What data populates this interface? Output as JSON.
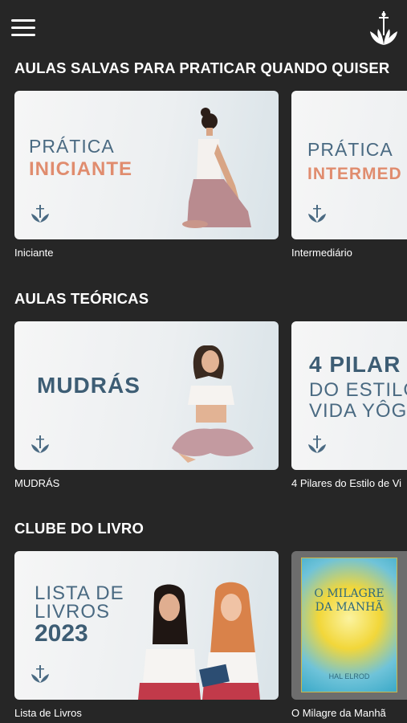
{
  "sections": [
    {
      "title": "AULAS SALVAS PARA PRATICAR QUANDO QUISER",
      "items": [
        {
          "caption": "Iniciante",
          "thumb_line1": "PRÁTICA",
          "thumb_line2": "INICIANTE"
        },
        {
          "caption": "Intermediário",
          "thumb_line1": "PRÁTICA",
          "thumb_line2": "INTERMED"
        }
      ]
    },
    {
      "title": "AULAS TEÓRICAS",
      "items": [
        {
          "caption": "MUDRÁS",
          "thumb_title": "MUDRÁS"
        },
        {
          "caption": "4 Pilares do Estilo de Vi",
          "thumb_l1": "4 PILAR",
          "thumb_l2": "DO ESTILO",
          "thumb_l3": "VIDA YÔGI"
        }
      ]
    },
    {
      "title": "CLUBE DO LIVRO",
      "items": [
        {
          "caption": "Lista de Livros",
          "thumb_l1": "LISTA DE",
          "thumb_l2": "LIVROS",
          "thumb_year": "2023"
        },
        {
          "caption": "O Milagre da Manhã",
          "book_title": "O MILAGRE DA MANHÃ",
          "book_author": "HAL ELROD"
        }
      ]
    }
  ],
  "icons": {
    "menu": "hamburger-menu-icon",
    "logo": "lotus-logo-icon"
  },
  "colors": {
    "background": "#262626",
    "accent_orange": "#e08c6e",
    "accent_blue": "#3d5d74"
  }
}
